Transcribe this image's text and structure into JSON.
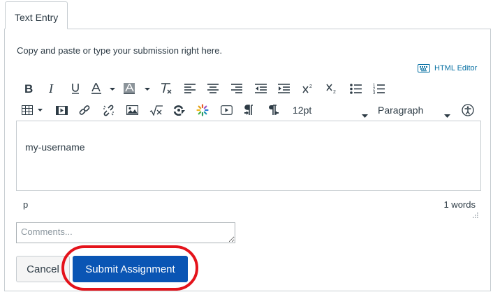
{
  "tabs": [
    {
      "label": "Text Entry",
      "active": true
    }
  ],
  "instructions": "Copy and paste or type your submission right here.",
  "html_editor_link": {
    "label": "HTML Editor",
    "icon": "keyboard-icon"
  },
  "toolbar": {
    "row1": [
      "bold-icon",
      "italic-icon",
      "underline-icon",
      "text-color-icon",
      "background-color-icon",
      "clear-formatting-icon",
      "align-left-icon",
      "align-center-icon",
      "align-right-icon",
      "outdent-icon",
      "indent-icon",
      "superscript-icon",
      "subscript-icon",
      "bullet-list-icon",
      "numbered-list-icon"
    ],
    "row2": [
      "table-icon",
      "media-icon",
      "link-icon",
      "unlink-icon",
      "image-icon",
      "equation-icon",
      "lti-tool-icon",
      "apps-icon",
      "embed-media-icon",
      "ltr-icon",
      "rtl-icon",
      "font-size-select",
      "block-format-select",
      "accessibility-icon"
    ],
    "font_size": "12pt",
    "block_format": "Paragraph"
  },
  "editor": {
    "content": "my-username"
  },
  "status": {
    "path": "p",
    "word_count": "1 words"
  },
  "comments": {
    "placeholder": "Comments...",
    "value": ""
  },
  "buttons": {
    "cancel": "Cancel",
    "submit": "Submit Assignment"
  },
  "colors": {
    "submit_bg": "#0a55b4",
    "highlight": "#e4131b",
    "link": "#0770a3",
    "text": "#2d3b45",
    "border": "#c7cdd1"
  }
}
